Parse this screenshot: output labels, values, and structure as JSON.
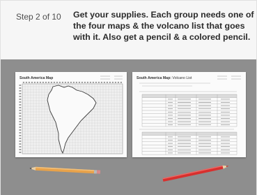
{
  "header": {
    "step_label": "Step 2 of 10",
    "instruction": "Get your supplies. Each group needs one of the four maps & the volcano list that goes with it. Also get a pencil & a colored pencil."
  },
  "map_sheet": {
    "title": "South America Map"
  },
  "list_sheet": {
    "title_bold": "South America Map:",
    "title_rest": "Volcano List"
  },
  "colors": {
    "background": "#8e8e8e",
    "header": "#f6f6f6",
    "pencil_yellow": "#e8a24a",
    "pencil_red": "#d8302e"
  }
}
